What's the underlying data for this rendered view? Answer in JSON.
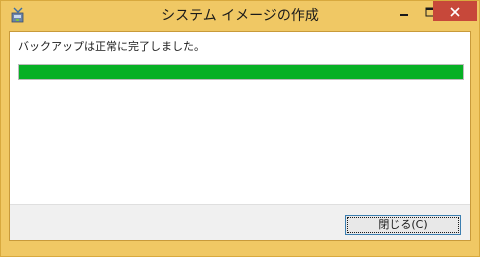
{
  "window": {
    "title": "システム イメージの作成",
    "app_icon": "system-image-backup-icon",
    "controls": {
      "minimize_icon": "minimize-icon",
      "maximize_icon": "maximize-icon",
      "close_icon": "close-icon"
    }
  },
  "main": {
    "message": "バックアップは正常に完了しました。",
    "progress": {
      "percent": 100,
      "color": "#06b025"
    }
  },
  "footer": {
    "close_button_label": "閉じる(C)"
  },
  "colors": {
    "window_frame": "#f0c864",
    "close_control": "#c7483a"
  }
}
